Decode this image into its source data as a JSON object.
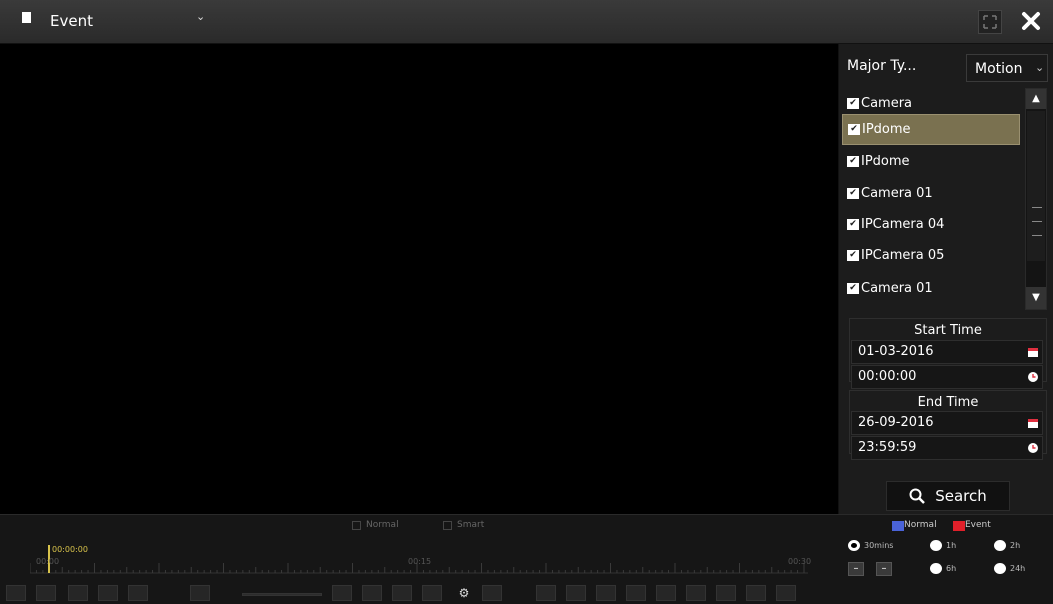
{
  "window": {
    "title": "Event"
  },
  "panel": {
    "major_type_label": "Major Ty...",
    "major_type_value": "Motion",
    "cameras": [
      {
        "label": "Camera",
        "checked": true,
        "selected": false
      },
      {
        "label": "IPdome",
        "checked": true,
        "selected": true
      },
      {
        "label": "IPdome",
        "checked": true,
        "selected": false
      },
      {
        "label": "Camera 01",
        "checked": true,
        "selected": false
      },
      {
        "label": "IPCamera 04",
        "checked": true,
        "selected": false
      },
      {
        "label": "IPCamera 05",
        "checked": true,
        "selected": false
      },
      {
        "label": "Camera 01",
        "checked": true,
        "selected": false
      }
    ],
    "start": {
      "heading": "Start Time",
      "date": "01-03-2016",
      "time": "00:00:00"
    },
    "end": {
      "heading": "End Time",
      "date": "26-09-2016",
      "time": "23:59:59"
    },
    "search_label": "Search"
  },
  "timeline": {
    "legend_normal": "Normal",
    "legend_smart": "Smart",
    "cursor_time": "00:00:00",
    "tick_left": "00:00",
    "tick_mid": "00:15",
    "tick_right": "00:30"
  },
  "legend": {
    "normal": "Normal",
    "event": "Event",
    "normal_color": "#4a63d8",
    "event_color": "#e0202a"
  },
  "ranges": {
    "r30": "30mins",
    "r1h": "1h",
    "r2h": "2h",
    "r6h": "6h",
    "r24h": "24h"
  }
}
